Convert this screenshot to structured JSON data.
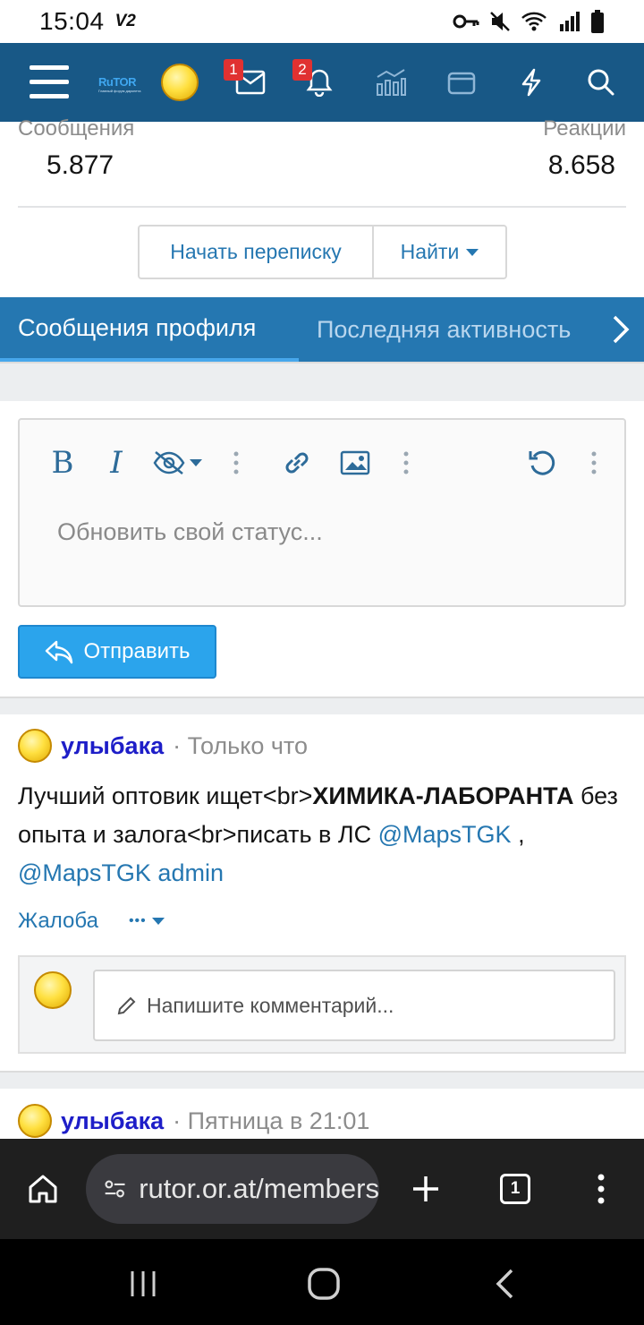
{
  "status_bar": {
    "time": "15:04",
    "network_tag": "V2"
  },
  "header": {
    "logo_text": "RuTOR",
    "logo_sub": "Главный форум даркнета",
    "badges": {
      "conversations": "1",
      "alerts": "2"
    }
  },
  "profile_stats": {
    "messages_label": "Сообщения",
    "messages_value": "5.877",
    "reactions_label": "Реакции",
    "reactions_value": "8.658"
  },
  "actions": {
    "start_conversation": "Начать переписку",
    "find": "Найти"
  },
  "tabs": [
    {
      "label": "Сообщения профиля"
    },
    {
      "label": "Последняя активность"
    }
  ],
  "editor": {
    "placeholder": "Обновить свой статус...",
    "submit_label": "Отправить"
  },
  "posts": [
    {
      "user": "улыбака",
      "time": "· Только что",
      "body_part1": "Лучший оптовик ищет<br>",
      "body_bold": "ХИМИКА-ЛАБОРАНТА",
      "body_part2": " без опыта и залога<br>писать в ЛС ",
      "mention1": "@MapsTGK",
      "separator": " , ",
      "mention2": "@MapsTGK admin",
      "report": "Жалоба",
      "more": "•••"
    },
    {
      "user": "улыбака",
      "time": "· Пятница в 21:01"
    }
  ],
  "comment": {
    "placeholder": "Напишите комментарий..."
  },
  "browser": {
    "url": "rutor.or.at/members",
    "tab_count": "1"
  }
}
